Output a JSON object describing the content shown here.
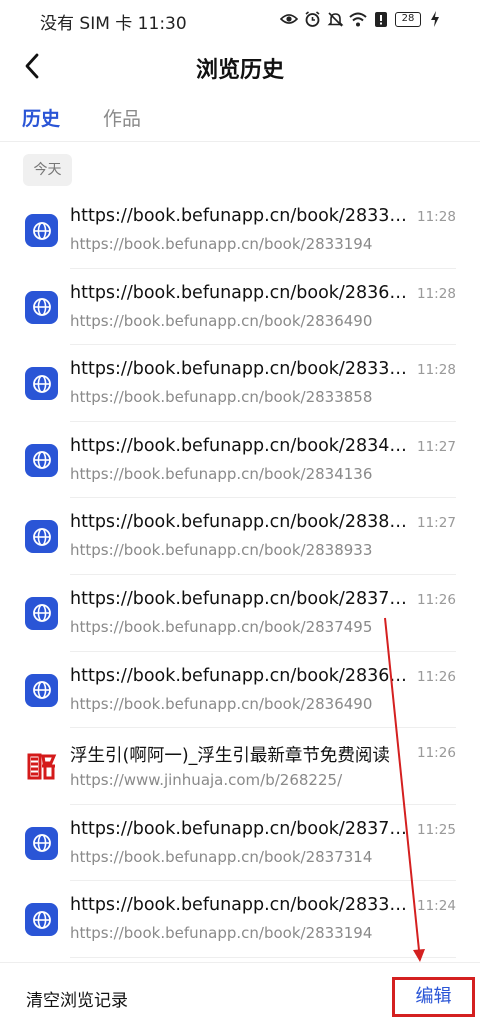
{
  "status_bar": {
    "carrier_time": "没有 SIM 卡 11:30",
    "battery": "28",
    "icons": [
      "eye-icon",
      "alarm-icon",
      "mute-icon",
      "wifi-icon",
      "alert-icon",
      "battery-icon",
      "charging-icon"
    ]
  },
  "header": {
    "title": "浏览历史"
  },
  "tabs": [
    {
      "label": "历史",
      "active": true
    },
    {
      "label": "作品",
      "active": false
    }
  ],
  "date_group": "今天",
  "history": [
    {
      "title": "https://book.befunapp.cn/book/2833194",
      "time": "11:28",
      "url": "https://book.befunapp.cn/book/2833194",
      "icon": "globe-icon"
    },
    {
      "title": "https://book.befunapp.cn/book/2836490",
      "time": "11:28",
      "url": "https://book.befunapp.cn/book/2836490",
      "icon": "globe-icon"
    },
    {
      "title": "https://book.befunapp.cn/book/2833858",
      "time": "11:28",
      "url": "https://book.befunapp.cn/book/2833858",
      "icon": "globe-icon"
    },
    {
      "title": "https://book.befunapp.cn/book/2834136",
      "time": "11:27",
      "url": "https://book.befunapp.cn/book/2834136",
      "icon": "globe-icon"
    },
    {
      "title": "https://book.befunapp.cn/book/2838933",
      "time": "11:27",
      "url": "https://book.befunapp.cn/book/2838933",
      "icon": "globe-icon"
    },
    {
      "title": "https://book.befunapp.cn/book/2837495",
      "time": "11:26",
      "url": "https://book.befunapp.cn/book/2837495",
      "icon": "globe-icon"
    },
    {
      "title": "https://book.befunapp.cn/book/2836490",
      "time": "11:26",
      "url": "https://book.befunapp.cn/book/2836490",
      "icon": "globe-icon"
    },
    {
      "title": "浮生引(啊阿一)_浮生引最新章节免费阅读",
      "time": "11:26",
      "url": "https://www.jinhuaja.com/b/268225/",
      "icon": "site-logo-icon"
    },
    {
      "title": "https://book.befunapp.cn/book/2837314",
      "time": "11:25",
      "url": "https://book.befunapp.cn/book/2837314",
      "icon": "globe-icon"
    },
    {
      "title": "https://book.befunapp.cn/book/2833194",
      "time": "11:24",
      "url": "https://book.befunapp.cn/book/2833194",
      "icon": "globe-icon"
    }
  ],
  "footer": {
    "clear_label": "清空浏览记录",
    "edit_label": "编辑"
  },
  "colors": {
    "accent": "#2a55d6",
    "annotation": "#d42020"
  }
}
